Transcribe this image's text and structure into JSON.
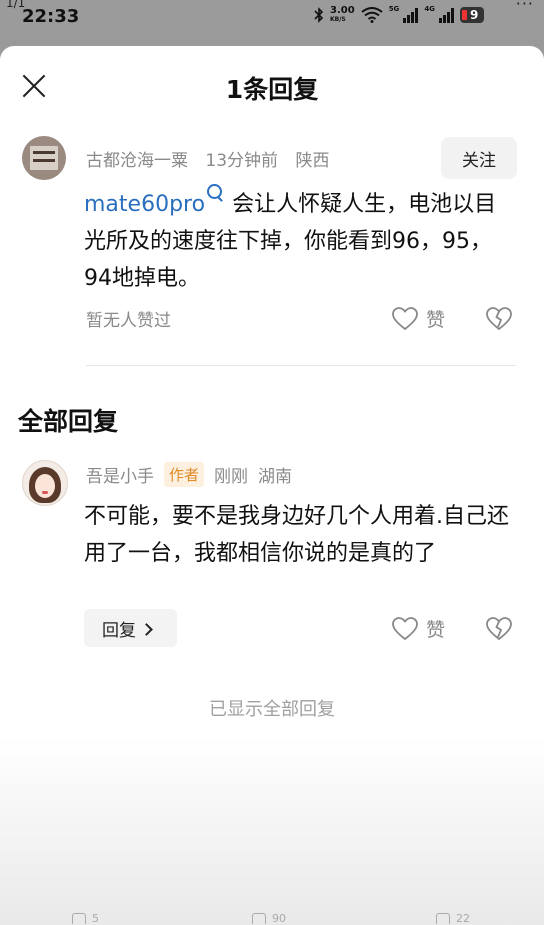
{
  "status_bar": {
    "page_indicator": "1/1",
    "time": "22:33",
    "net_speed": "3.00",
    "net_speed_unit": "KB/S",
    "sim1_label": "5G",
    "sim2_label": "4G",
    "battery": "9",
    "more": "···"
  },
  "header": {
    "title": "1条回复"
  },
  "main_comment": {
    "username": "古都沧海一粟",
    "time": "13分钟前",
    "location": "陕西",
    "follow_label": "关注",
    "link_text": "mate60pro",
    "text": "会让人怀疑人生，电池以目光所及的速度往下掉，你能看到96，95，94地掉电。",
    "no_likes": "暂无人赞过",
    "like_label": "赞"
  },
  "section": {
    "all_replies_title": "全部回复"
  },
  "reply": {
    "username": "吾是小手",
    "author_tag": "作者",
    "time": "刚刚",
    "location": "湖南",
    "text": "不可能，要不是我身边好几个人用着.自己还用了一台，我都相信你说的是真的了",
    "reply_label": "回复",
    "like_label": "赞"
  },
  "footer": {
    "all_shown": "已显示全部回复"
  },
  "bottom_bar": {
    "share_count": "5",
    "comment_count": "90",
    "like_count": "22"
  },
  "colors": {
    "link": "#2a6fbf",
    "author_tag_text": "#e08a2a",
    "author_tag_bg": "#fdf0df"
  }
}
